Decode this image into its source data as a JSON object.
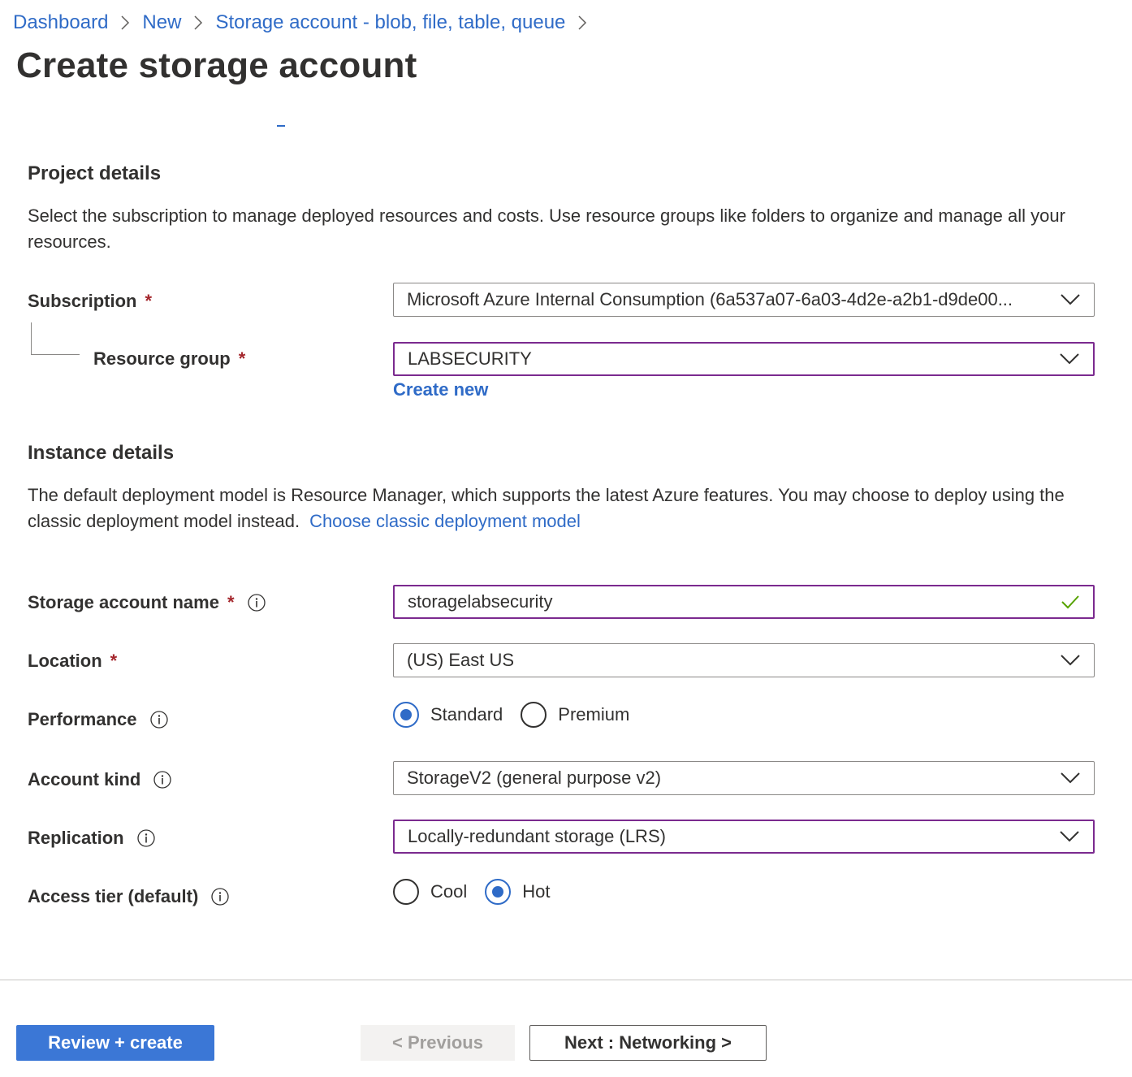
{
  "breadcrumb": {
    "items": [
      "Dashboard",
      "New",
      "Storage account - blob, file, table, queue"
    ]
  },
  "page_title": "Create storage account",
  "project_details": {
    "title": "Project details",
    "description": "Select the subscription to manage deployed resources and costs. Use resource groups like folders to organize and manage all your resources.",
    "subscription_label": "Subscription",
    "subscription_value": "Microsoft Azure Internal Consumption (6a537a07-6a03-4d2e-a2b1-d9de00...",
    "resource_group_label": "Resource group",
    "resource_group_value": "LABSECURITY",
    "create_new": "Create new"
  },
  "instance_details": {
    "title": "Instance details",
    "description": "The default deployment model is Resource Manager, which supports the latest Azure features. You may choose to deploy using the classic deployment model instead.",
    "classic_link": "Choose classic deployment model",
    "storage_name_label": "Storage account name",
    "storage_name_value": "storagelabsecurity",
    "location_label": "Location",
    "location_value": "(US) East US",
    "performance_label": "Performance",
    "performance_options": [
      "Standard",
      "Premium"
    ],
    "performance_selected": "Standard",
    "account_kind_label": "Account kind",
    "account_kind_value": "StorageV2 (general purpose v2)",
    "replication_label": "Replication",
    "replication_value": "Locally-redundant storage (LRS)",
    "access_tier_label": "Access tier (default)",
    "access_tier_options": [
      "Cool",
      "Hot"
    ],
    "access_tier_selected": "Hot"
  },
  "required_marker": "*",
  "footer": {
    "review_create": "Review + create",
    "previous": "< Previous",
    "next": "Next : Networking >"
  },
  "colors": {
    "link": "#2f6bc7",
    "primary": "#3b77d6",
    "active_border": "#7b2a8f",
    "required": "#a4262c",
    "valid_check": "#57a300"
  },
  "icons": {
    "breadcrumb_separator": "chevron-right-icon",
    "dropdown": "chevron-down-icon",
    "info": "info-icon",
    "valid": "checkmark-icon"
  }
}
